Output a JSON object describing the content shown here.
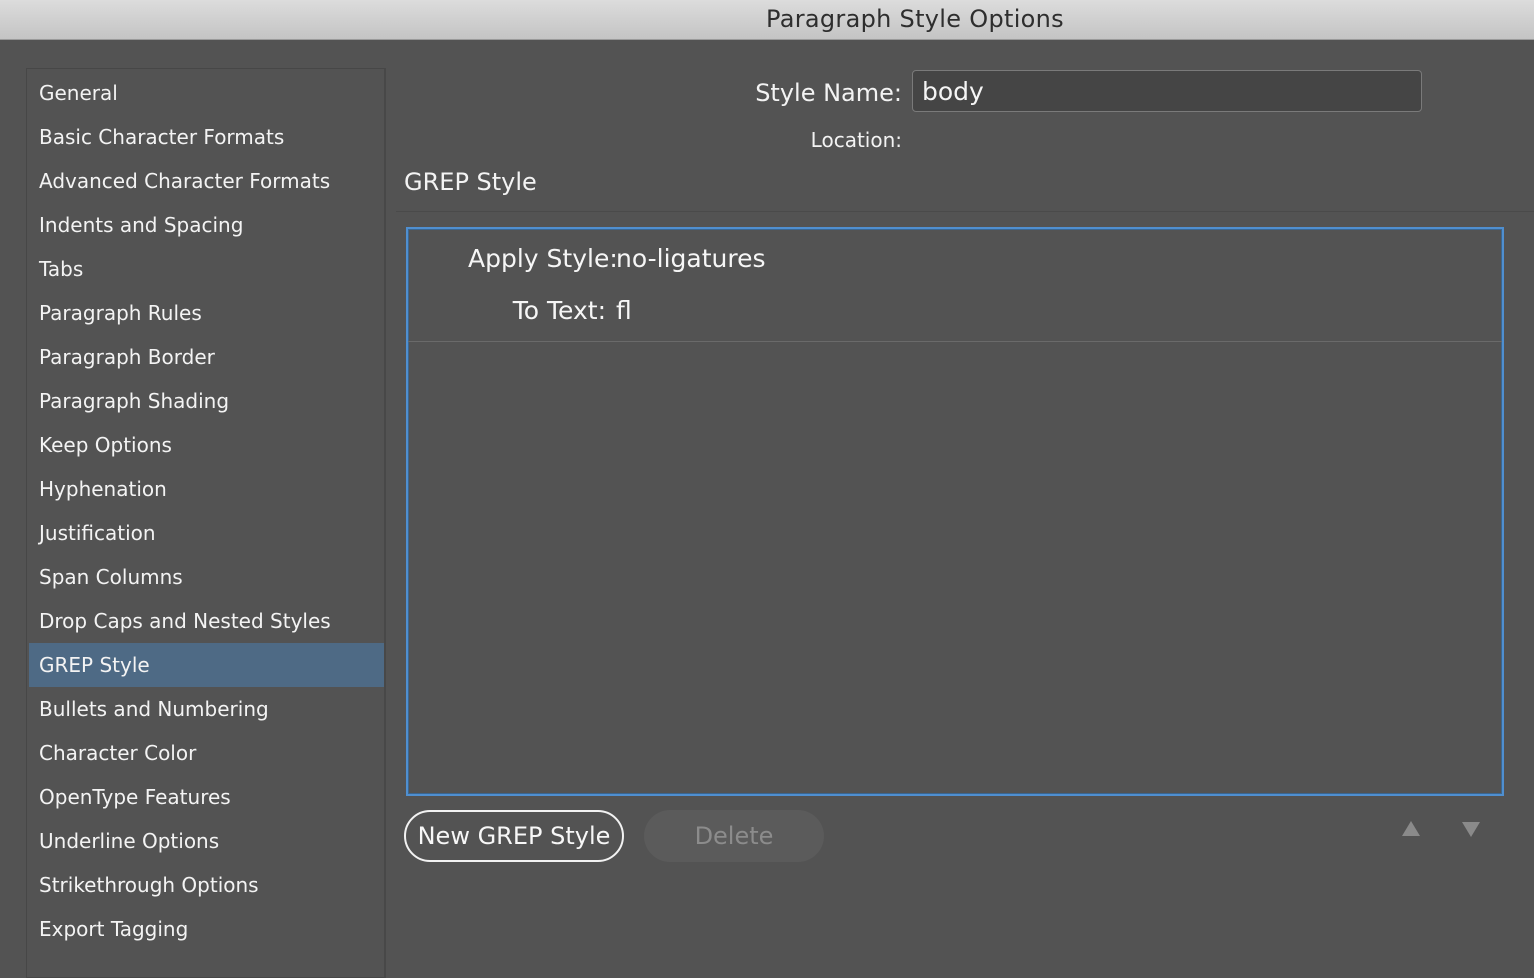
{
  "window": {
    "title": "Paragraph Style Options"
  },
  "sidebar": {
    "selected_index": 13,
    "items": [
      {
        "label": "General"
      },
      {
        "label": "Basic Character Formats"
      },
      {
        "label": "Advanced Character Formats"
      },
      {
        "label": "Indents and Spacing"
      },
      {
        "label": "Tabs"
      },
      {
        "label": "Paragraph Rules"
      },
      {
        "label": "Paragraph Border"
      },
      {
        "label": "Paragraph Shading"
      },
      {
        "label": "Keep Options"
      },
      {
        "label": "Hyphenation"
      },
      {
        "label": "Justification"
      },
      {
        "label": "Span Columns"
      },
      {
        "label": "Drop Caps and Nested Styles"
      },
      {
        "label": "GREP Style"
      },
      {
        "label": "Bullets and Numbering"
      },
      {
        "label": "Character Color"
      },
      {
        "label": "OpenType Features"
      },
      {
        "label": "Underline Options"
      },
      {
        "label": "Strikethrough Options"
      },
      {
        "label": "Export Tagging"
      }
    ]
  },
  "header": {
    "style_name_label": "Style Name:",
    "style_name_value": "body",
    "location_label": "Location:"
  },
  "section": {
    "title": "GREP Style"
  },
  "grep_styles": [
    {
      "apply_style_label": "Apply Style:",
      "apply_style_value": "no-ligatures",
      "to_text_label": "To Text:",
      "to_text_value": "fl"
    }
  ],
  "buttons": {
    "new_grep_style": "New GREP Style",
    "delete": "Delete"
  },
  "icons": {
    "move_up": "triangle-up-icon",
    "move_down": "triangle-down-icon"
  },
  "colors": {
    "selection": "#4e6a85",
    "focus_ring": "#4f8fd0",
    "background": "#535353"
  }
}
